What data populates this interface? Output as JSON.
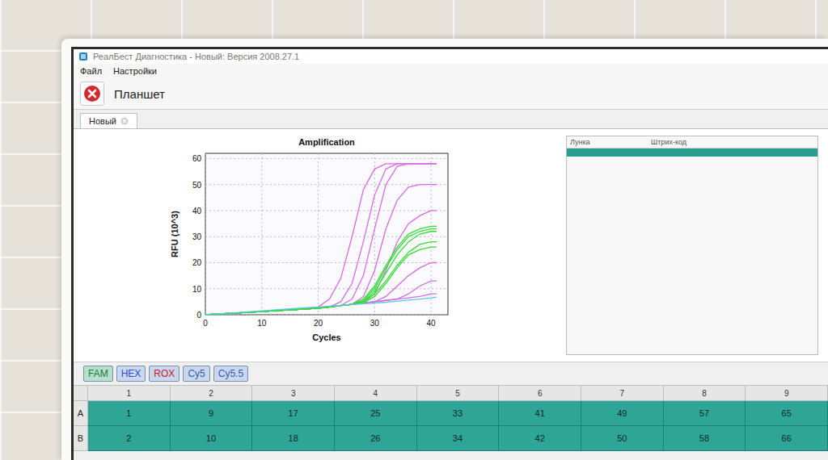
{
  "window": {
    "title": "РеалБест Диагностика - Новый: Версия 2008.27.1"
  },
  "menu": [
    "Файл",
    "Настройки"
  ],
  "toolbar": {
    "title": "Планшет"
  },
  "tabs": [
    {
      "label": "Новый",
      "selected": true
    }
  ],
  "chart": {
    "title": "Amplification",
    "y_label": "RFU (10^3)",
    "x_label": "Cycles",
    "y_ticks": [
      "0",
      "10",
      "20",
      "30",
      "40",
      "50",
      "60"
    ],
    "x_ticks": [
      "0",
      "10",
      "20",
      "30",
      "40"
    ],
    "cycles": [
      0,
      4,
      8,
      12,
      16,
      20,
      22,
      24,
      26,
      28,
      30,
      32,
      34,
      36,
      38,
      40,
      41
    ],
    "series": [
      {
        "color": "#d66be6",
        "values": [
          0,
          0.5,
          1,
          1.5,
          2,
          3,
          6,
          14,
          30,
          48,
          56,
          58,
          58,
          58,
          58,
          58,
          58
        ]
      },
      {
        "color": "#d66be6",
        "values": [
          0,
          0.5,
          1,
          1.5,
          2,
          2.5,
          3,
          5,
          12,
          28,
          46,
          56,
          58,
          58,
          58,
          58,
          58
        ]
      },
      {
        "color": "#d66be6",
        "values": [
          0,
          0.5,
          1,
          1.5,
          2,
          2.5,
          3,
          3.5,
          6,
          15,
          33,
          50,
          57,
          58,
          58,
          58,
          58
        ]
      },
      {
        "color": "#d66be6",
        "values": [
          0,
          0.5,
          1,
          1.5,
          2,
          2.5,
          3,
          3.5,
          4,
          7,
          17,
          33,
          44,
          49,
          50,
          50,
          50
        ]
      },
      {
        "color": "#d66be6",
        "values": [
          0,
          0.5,
          1,
          1.5,
          2,
          2.5,
          3,
          3.5,
          4,
          4.5,
          8,
          17,
          28,
          35,
          38,
          40,
          40
        ]
      },
      {
        "color": "#d66be6",
        "values": [
          0,
          0.5,
          1,
          1.5,
          2,
          2.5,
          3,
          3.5,
          4,
          4.5,
          5,
          7,
          11,
          15,
          18,
          20,
          20
        ]
      },
      {
        "color": "#d66be6",
        "values": [
          0,
          0.5,
          1,
          1.5,
          2,
          2.5,
          3,
          3.5,
          4,
          4.5,
          5,
          5.5,
          6,
          8,
          11,
          13,
          13
        ]
      },
      {
        "color": "#d66be6",
        "values": [
          0,
          0.5,
          1,
          1.5,
          2,
          2.5,
          3,
          3.5,
          4,
          4.5,
          5,
          5.5,
          6,
          6.5,
          7,
          8,
          8
        ]
      },
      {
        "color": "#33dd33",
        "values": [
          0,
          0.5,
          1,
          1.5,
          2,
          2.5,
          3,
          3.5,
          4,
          6,
          11,
          19,
          26,
          31,
          33,
          34,
          34
        ]
      },
      {
        "color": "#33dd33",
        "values": [
          0,
          0.5,
          1,
          1.5,
          2,
          2.5,
          3,
          3.5,
          4,
          5,
          9,
          16,
          23,
          28,
          31,
          32,
          32
        ]
      },
      {
        "color": "#33dd33",
        "values": [
          0,
          0.5,
          1,
          1.5,
          2,
          2.5,
          3,
          3.5,
          4,
          5,
          8,
          13,
          19,
          24,
          27,
          28,
          28
        ]
      },
      {
        "color": "#33dd33",
        "values": [
          0,
          0.5,
          1,
          1.5,
          2,
          2.5,
          3,
          3.5,
          4,
          4.5,
          7,
          12,
          18,
          23,
          25,
          26,
          26
        ]
      },
      {
        "color": "#33dd33",
        "values": [
          0,
          0.5,
          1,
          1.5,
          2,
          2.5,
          3,
          3.5,
          4,
          5.5,
          10,
          18,
          25,
          30,
          32,
          33,
          33
        ]
      },
      {
        "color": "#5ec8e0",
        "values": [
          0,
          0.6,
          1.2,
          1.8,
          2.4,
          3,
          3.3,
          3.6,
          3.9,
          4.2,
          4.5,
          4.8,
          5.2,
          5.6,
          6,
          6.5,
          6.8
        ]
      }
    ]
  },
  "well_table": {
    "columns": [
      "Лунка",
      "Штрих-код"
    ],
    "rows": [
      {
        "selected": true
      }
    ]
  },
  "channels": [
    {
      "label": "FAM",
      "color": "#1e7a3a",
      "selected": true
    },
    {
      "label": "HEX",
      "color": "#2a4bd0",
      "selected": false
    },
    {
      "label": "ROX",
      "color": "#c8202a",
      "selected": false
    },
    {
      "label": "Cy5",
      "color": "#3060b0",
      "selected": false
    },
    {
      "label": "Cy5.5",
      "color": "#3060b0",
      "selected": false
    }
  ],
  "plate": {
    "columns": [
      "1",
      "2",
      "3",
      "4",
      "5",
      "6",
      "7",
      "8",
      "9"
    ],
    "rows": [
      {
        "label": "A",
        "cells": [
          "1",
          "9",
          "17",
          "25",
          "33",
          "41",
          "49",
          "57",
          "65"
        ]
      },
      {
        "label": "B",
        "cells": [
          "2",
          "10",
          "18",
          "26",
          "34",
          "42",
          "50",
          "58",
          "66"
        ]
      }
    ]
  }
}
